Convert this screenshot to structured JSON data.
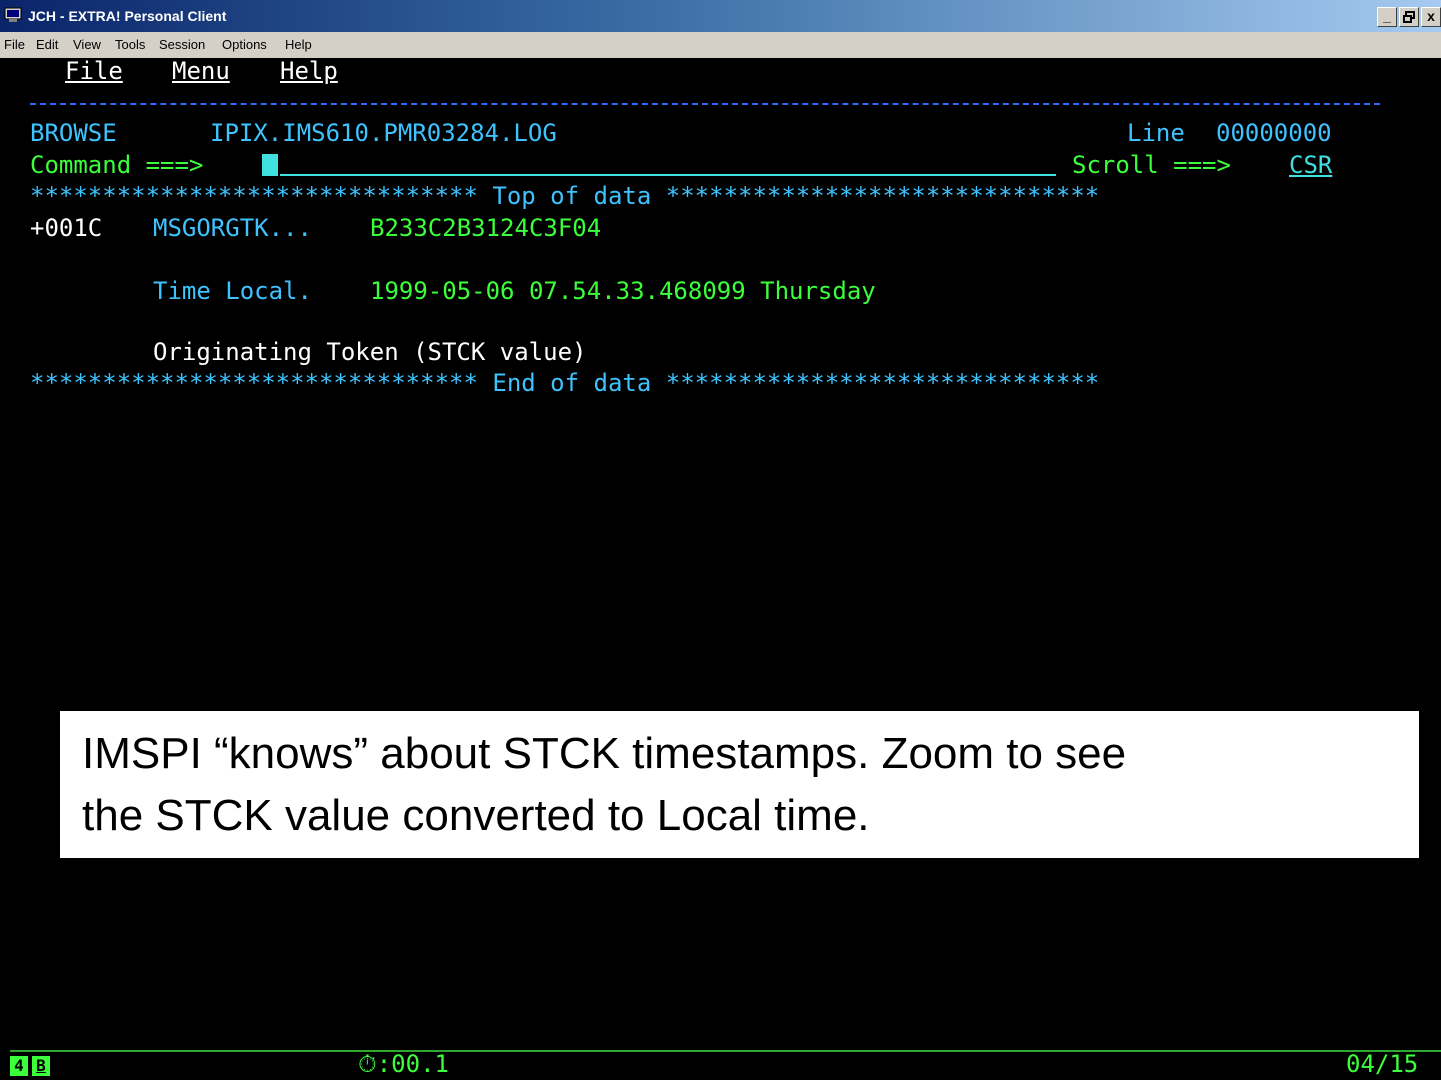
{
  "window": {
    "title": "JCH - EXTRA! Personal Client",
    "buttons": {
      "minimize": "_",
      "maximize": "`",
      "close": "x"
    }
  },
  "menubar": {
    "items": [
      "File",
      "Edit",
      "View",
      "Tools",
      "Session",
      "Options",
      "Help"
    ]
  },
  "ispf": {
    "action_bar": {
      "file": "File",
      "menu": "Menu",
      "help": "Help"
    },
    "mode": "BROWSE",
    "dataset": "IPIX.IMS610.PMR03284.LOG",
    "line_label": "Line",
    "line_value": "00000000",
    "command_label": "Command ===>",
    "scroll_label": "Scroll ===>",
    "scroll_value": "CSR",
    "top_of_data": "******************************* Top of data ******************************",
    "offset": "+001C",
    "field_name": "MSGORGTK...",
    "field_value": "B233C2B3124C3F04",
    "time_label": "Time Local.",
    "time_value": "1999-05-06 07.54.33.468099 Thursday",
    "token_label": "Originating Token (STCK value)",
    "end_of_data": "******************************* End of data ******************************"
  },
  "callout": {
    "line1": "IMSPI “knows” about STCK timestamps. Zoom to see",
    "line2": "the STCK value converted to Local time."
  },
  "status": {
    "indicator1": "4",
    "indicator2": "B",
    "timer": "⏱:00.1",
    "cursor_pos": "04/15"
  },
  "colors": {
    "background": "#000000",
    "field_cyan": "#3ec3ff",
    "input_cyan": "#40e0e0",
    "value_green": "#3cff3c",
    "divider_blue": "#2f6cff"
  }
}
